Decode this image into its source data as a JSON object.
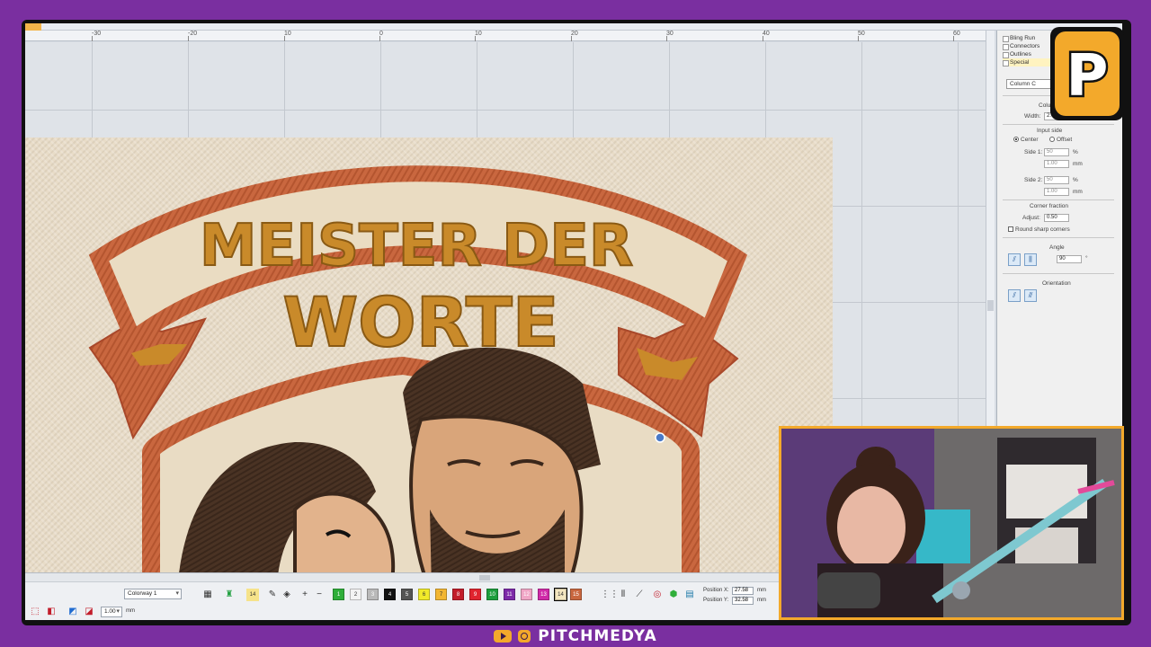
{
  "window": {
    "ruler_ticks": [
      "-30",
      "-20",
      "10",
      "0",
      "10",
      "20",
      "30",
      "40",
      "50",
      "60"
    ]
  },
  "design": {
    "banner_line1": "MEISTER DER",
    "banner_line2": "WORTE",
    "colors": {
      "fabric": "#e8dcc8",
      "banner_border": "#c9673f",
      "banner_fill": "#eadcc2",
      "lettering": "#c98a2a",
      "hair": "#4a3324",
      "skin": "#d9a57a"
    }
  },
  "properties_panel": {
    "tree": [
      "Bling Run",
      "Connectors",
      "Outlines",
      "Special"
    ],
    "type_select": "Column C",
    "column_label": "Column",
    "width_label": "Width:",
    "width_value": "2.00",
    "input_side_label": "Input side",
    "center_label": "Center",
    "offset_label": "Offset",
    "side1_label": "Side 1:",
    "side1_pct": "50",
    "side1_mm": "1.00",
    "side2_label": "Side 2:",
    "side2_pct": "50",
    "side2_mm": "1.00",
    "pct_unit": "%",
    "mm_unit": "mm",
    "corner_fraction_label": "Corner fraction",
    "adjust_label": "Adjust:",
    "adjust_value": "0.50",
    "round_corners_label": "Round sharp corners",
    "angle_label": "Angle",
    "angle_value": "90",
    "angle_unit": "°",
    "orientation_label": "Orientation"
  },
  "toolbar": {
    "colorway_select": "Colorway 1",
    "swatch_14_label": "14",
    "swatches": [
      {
        "label": "1",
        "color": "#2fae3a"
      },
      {
        "label": "2",
        "color": "#f3f3f3"
      },
      {
        "label": "3",
        "color": "#b9b9b9"
      },
      {
        "label": "4",
        "color": "#111111"
      },
      {
        "label": "5",
        "color": "#555555"
      },
      {
        "label": "6",
        "color": "#f1ea2a"
      },
      {
        "label": "7",
        "color": "#f2b633"
      },
      {
        "label": "8",
        "color": "#c21d2a"
      },
      {
        "label": "9",
        "color": "#e0242f"
      },
      {
        "label": "10",
        "color": "#1d9e3d"
      },
      {
        "label": "11",
        "color": "#7d2aa8"
      },
      {
        "label": "12",
        "color": "#f0a6c6"
      },
      {
        "label": "13",
        "color": "#d02aa8"
      },
      {
        "label": "14",
        "color": "#f3e6c0"
      },
      {
        "label": "15",
        "color": "#c9673f"
      }
    ],
    "zoom_value": "1.00",
    "zoom_unit": "mm",
    "position_x_label": "Position X:",
    "position_x_value": "27.58",
    "position_y_label": "Position Y:",
    "position_y_value": "32.58",
    "pos_unit": "mm"
  },
  "footer": {
    "handle": "PITCHMEDYA"
  },
  "logo": {
    "letter": "P"
  }
}
